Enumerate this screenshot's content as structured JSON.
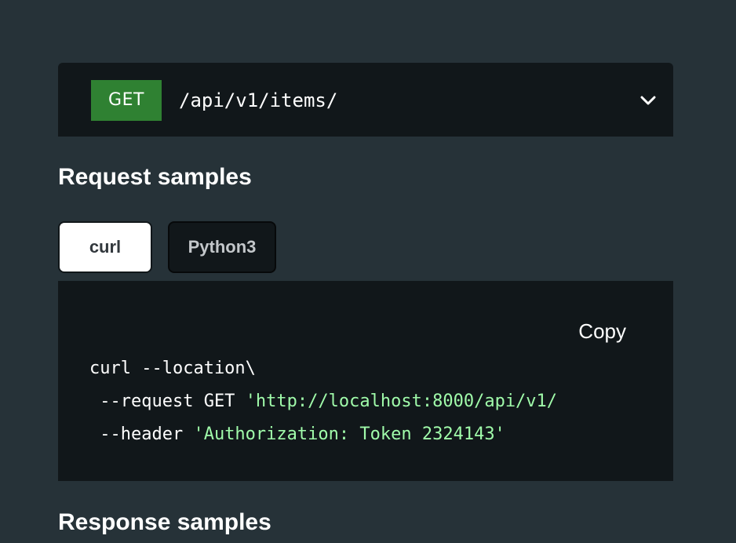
{
  "endpoint": {
    "method": "GET",
    "path": "/api/v1/items/",
    "toggle_icon": "chevron-down-icon",
    "method_color": "#2f8132"
  },
  "request_samples": {
    "title": "Request samples",
    "tabs": [
      {
        "label": "curl",
        "selected": true
      },
      {
        "label": "Python3",
        "selected": false
      }
    ],
    "copy_label": "Copy",
    "code": {
      "line1": "curl --location\\",
      "line2_keyword": " --request GET ",
      "line2_string": "'http://localhost:8000/api/v1/",
      "line3_keyword": " --header ",
      "line3_string": "'Authorization: Token 2324143'"
    },
    "string_color": "#a0fbaa"
  },
  "response_samples": {
    "title": "Response samples"
  }
}
